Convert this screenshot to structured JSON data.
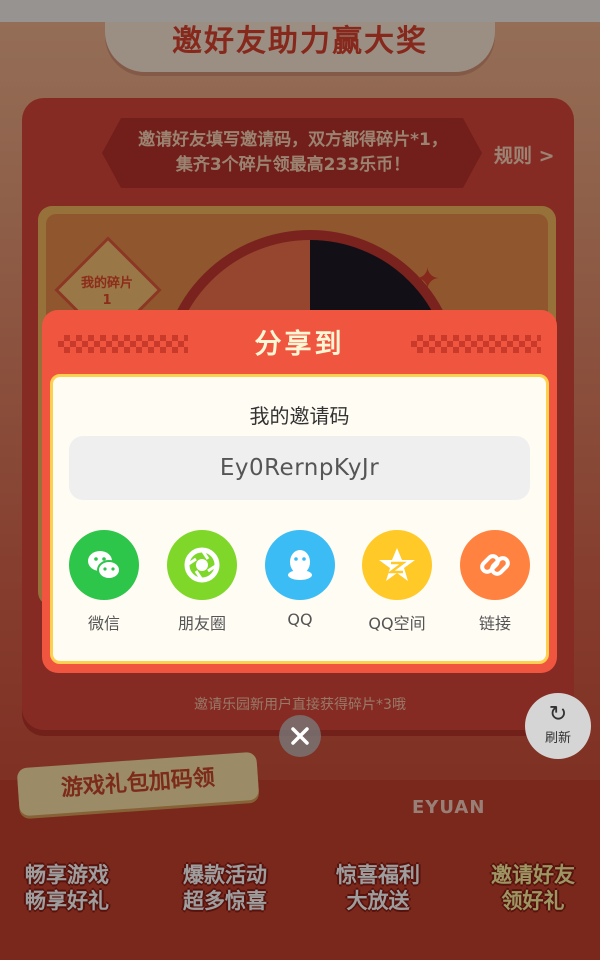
{
  "background": {
    "banner_title": "邀好友助力赢大奖",
    "intro_text": "邀请好友填写邀请码，双方都得碎片*1，集齐3个碎片领最高233乐币！",
    "rules_link": "规则 >",
    "fragment_label": "我的碎片",
    "fragment_count": "1",
    "bottom_hint": "邀请乐园新用户直接获得碎片*3哦",
    "refresh_label": "刷新",
    "promo_tag": "游戏礼包加码领",
    "brand_mark": "EYUAN",
    "promo_items": [
      {
        "line1": "畅享游戏",
        "line2": "畅享好礼"
      },
      {
        "line1": "爆款活动",
        "line2": "超多惊喜"
      },
      {
        "line1": "惊喜福利",
        "line2": "大放送"
      },
      {
        "line1": "邀请好友",
        "line2": "领好礼"
      }
    ]
  },
  "dialog": {
    "title": "分享到",
    "code_label": "我的邀请码",
    "invite_code": "Ey0RernpKyJr",
    "share_options": [
      {
        "label": "微信",
        "icon": "wechat-icon",
        "color": "#2dc54a"
      },
      {
        "label": "朋友圈",
        "icon": "moments-icon",
        "color": "#7fd72a"
      },
      {
        "label": "QQ",
        "icon": "qq-icon",
        "color": "#3bbcf5"
      },
      {
        "label": "QQ空间",
        "icon": "qzone-icon",
        "color": "#ffc928"
      },
      {
        "label": "链接",
        "icon": "link-icon",
        "color": "#ff8240"
      }
    ]
  },
  "colors": {
    "dialog_red": "#f0563f",
    "dialog_border": "#ffcf4e",
    "overlay": "rgba(0,0,0,0.38)"
  }
}
